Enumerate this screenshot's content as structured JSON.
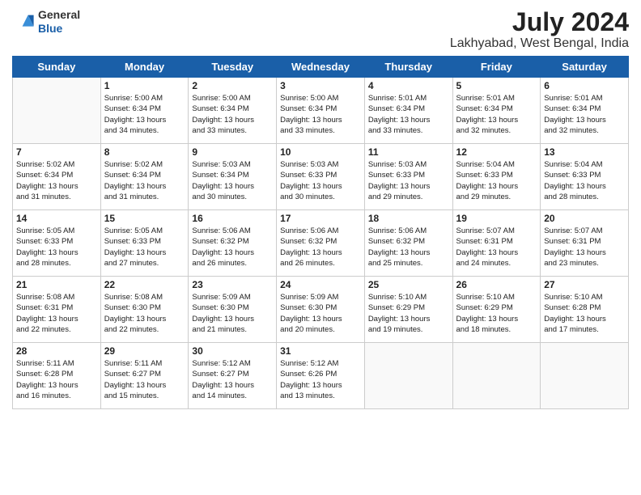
{
  "header": {
    "logo_line1": "General",
    "logo_line2": "Blue",
    "month_title": "July 2024",
    "location": "Lakhyabad, West Bengal, India"
  },
  "days_of_week": [
    "Sunday",
    "Monday",
    "Tuesday",
    "Wednesday",
    "Thursday",
    "Friday",
    "Saturday"
  ],
  "weeks": [
    [
      {
        "day": "",
        "info": ""
      },
      {
        "day": "1",
        "info": "Sunrise: 5:00 AM\nSunset: 6:34 PM\nDaylight: 13 hours\nand 34 minutes."
      },
      {
        "day": "2",
        "info": "Sunrise: 5:00 AM\nSunset: 6:34 PM\nDaylight: 13 hours\nand 33 minutes."
      },
      {
        "day": "3",
        "info": "Sunrise: 5:00 AM\nSunset: 6:34 PM\nDaylight: 13 hours\nand 33 minutes."
      },
      {
        "day": "4",
        "info": "Sunrise: 5:01 AM\nSunset: 6:34 PM\nDaylight: 13 hours\nand 33 minutes."
      },
      {
        "day": "5",
        "info": "Sunrise: 5:01 AM\nSunset: 6:34 PM\nDaylight: 13 hours\nand 32 minutes."
      },
      {
        "day": "6",
        "info": "Sunrise: 5:01 AM\nSunset: 6:34 PM\nDaylight: 13 hours\nand 32 minutes."
      }
    ],
    [
      {
        "day": "7",
        "info": "Sunrise: 5:02 AM\nSunset: 6:34 PM\nDaylight: 13 hours\nand 31 minutes."
      },
      {
        "day": "8",
        "info": "Sunrise: 5:02 AM\nSunset: 6:34 PM\nDaylight: 13 hours\nand 31 minutes."
      },
      {
        "day": "9",
        "info": "Sunrise: 5:03 AM\nSunset: 6:34 PM\nDaylight: 13 hours\nand 30 minutes."
      },
      {
        "day": "10",
        "info": "Sunrise: 5:03 AM\nSunset: 6:33 PM\nDaylight: 13 hours\nand 30 minutes."
      },
      {
        "day": "11",
        "info": "Sunrise: 5:03 AM\nSunset: 6:33 PM\nDaylight: 13 hours\nand 29 minutes."
      },
      {
        "day": "12",
        "info": "Sunrise: 5:04 AM\nSunset: 6:33 PM\nDaylight: 13 hours\nand 29 minutes."
      },
      {
        "day": "13",
        "info": "Sunrise: 5:04 AM\nSunset: 6:33 PM\nDaylight: 13 hours\nand 28 minutes."
      }
    ],
    [
      {
        "day": "14",
        "info": "Sunrise: 5:05 AM\nSunset: 6:33 PM\nDaylight: 13 hours\nand 28 minutes."
      },
      {
        "day": "15",
        "info": "Sunrise: 5:05 AM\nSunset: 6:33 PM\nDaylight: 13 hours\nand 27 minutes."
      },
      {
        "day": "16",
        "info": "Sunrise: 5:06 AM\nSunset: 6:32 PM\nDaylight: 13 hours\nand 26 minutes."
      },
      {
        "day": "17",
        "info": "Sunrise: 5:06 AM\nSunset: 6:32 PM\nDaylight: 13 hours\nand 26 minutes."
      },
      {
        "day": "18",
        "info": "Sunrise: 5:06 AM\nSunset: 6:32 PM\nDaylight: 13 hours\nand 25 minutes."
      },
      {
        "day": "19",
        "info": "Sunrise: 5:07 AM\nSunset: 6:31 PM\nDaylight: 13 hours\nand 24 minutes."
      },
      {
        "day": "20",
        "info": "Sunrise: 5:07 AM\nSunset: 6:31 PM\nDaylight: 13 hours\nand 23 minutes."
      }
    ],
    [
      {
        "day": "21",
        "info": "Sunrise: 5:08 AM\nSunset: 6:31 PM\nDaylight: 13 hours\nand 22 minutes."
      },
      {
        "day": "22",
        "info": "Sunrise: 5:08 AM\nSunset: 6:30 PM\nDaylight: 13 hours\nand 22 minutes."
      },
      {
        "day": "23",
        "info": "Sunrise: 5:09 AM\nSunset: 6:30 PM\nDaylight: 13 hours\nand 21 minutes."
      },
      {
        "day": "24",
        "info": "Sunrise: 5:09 AM\nSunset: 6:30 PM\nDaylight: 13 hours\nand 20 minutes."
      },
      {
        "day": "25",
        "info": "Sunrise: 5:10 AM\nSunset: 6:29 PM\nDaylight: 13 hours\nand 19 minutes."
      },
      {
        "day": "26",
        "info": "Sunrise: 5:10 AM\nSunset: 6:29 PM\nDaylight: 13 hours\nand 18 minutes."
      },
      {
        "day": "27",
        "info": "Sunrise: 5:10 AM\nSunset: 6:28 PM\nDaylight: 13 hours\nand 17 minutes."
      }
    ],
    [
      {
        "day": "28",
        "info": "Sunrise: 5:11 AM\nSunset: 6:28 PM\nDaylight: 13 hours\nand 16 minutes."
      },
      {
        "day": "29",
        "info": "Sunrise: 5:11 AM\nSunset: 6:27 PM\nDaylight: 13 hours\nand 15 minutes."
      },
      {
        "day": "30",
        "info": "Sunrise: 5:12 AM\nSunset: 6:27 PM\nDaylight: 13 hours\nand 14 minutes."
      },
      {
        "day": "31",
        "info": "Sunrise: 5:12 AM\nSunset: 6:26 PM\nDaylight: 13 hours\nand 13 minutes."
      },
      {
        "day": "",
        "info": ""
      },
      {
        "day": "",
        "info": ""
      },
      {
        "day": "",
        "info": ""
      }
    ]
  ]
}
